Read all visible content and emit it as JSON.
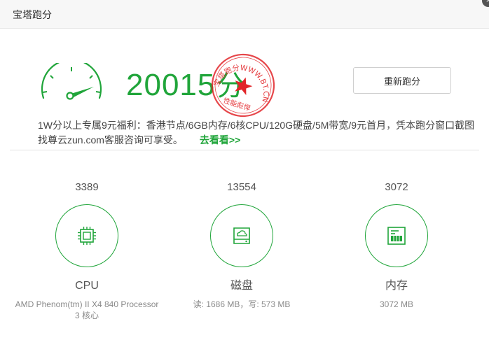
{
  "window": {
    "title": "宝塔跑分",
    "close_icon": "×"
  },
  "score": {
    "value": "20015",
    "unit": "分"
  },
  "stamp": {
    "top_text": "宝塔跑分WWW.BT.CN",
    "bottom_text": "性能彪悍",
    "color": "#e2262a"
  },
  "rerun_button": "重新跑分",
  "promo": {
    "text": "1W分以上专属9元福利：香港节点/6GB内存/6核CPU/120G硬盘/5M带宽/9元首月，凭本跑分窗口截图找尊云zun.com客服咨询可享受。",
    "link": "去看看>>"
  },
  "items": [
    {
      "score": "3389",
      "name": "CPU",
      "detail_1": "AMD Phenom(tm) II X4 840 Processor",
      "detail_2": "3 核心",
      "icon": "cpu-icon"
    },
    {
      "score": "13554",
      "name": "磁盘",
      "detail_1": "读: 1686 MB，写: 573 MB",
      "detail_2": "",
      "icon": "disk-icon"
    },
    {
      "score": "3072",
      "name": "内存",
      "detail_1": "3072 MB",
      "detail_2": "",
      "icon": "memory-icon"
    }
  ],
  "colors": {
    "accent": "#20a53a",
    "stamp": "#e2262a"
  }
}
